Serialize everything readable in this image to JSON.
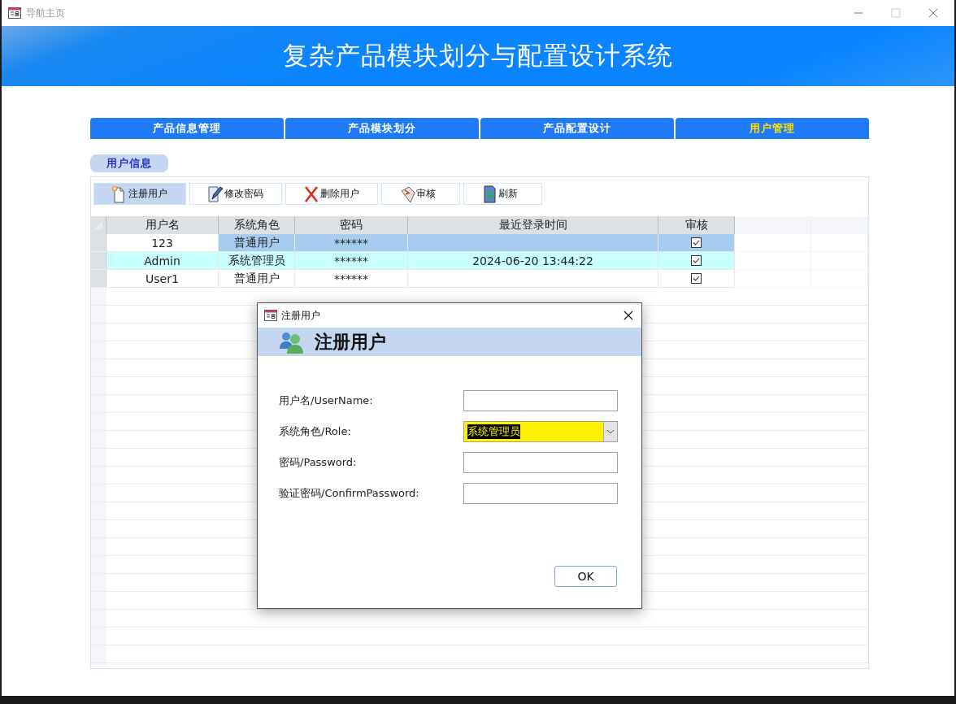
{
  "window": {
    "title": "导航主页"
  },
  "banner": {
    "title": "复杂产品模块划分与配置设计系统"
  },
  "tabs": [
    {
      "label": "产品信息管理",
      "selected": false
    },
    {
      "label": "产品模块划分",
      "selected": false
    },
    {
      "label": "产品配置设计",
      "selected": false
    },
    {
      "label": "用户管理",
      "selected": true
    }
  ],
  "section": {
    "label": "用户信息"
  },
  "toolbar": [
    {
      "label": "注册用户",
      "kind": "new",
      "selected": true
    },
    {
      "label": "修改密码",
      "kind": "edit",
      "selected": false
    },
    {
      "label": "删除用户",
      "kind": "delete",
      "selected": false
    },
    {
      "label": "审核",
      "kind": "review",
      "selected": false
    },
    {
      "label": "刷新",
      "kind": "refresh",
      "selected": false
    }
  ],
  "table": {
    "columns": [
      "用户名",
      "系统角色",
      "密码",
      "最近登录时间",
      "审核"
    ],
    "rows": [
      {
        "cells": [
          "123",
          "普通用户",
          "******",
          ""
        ],
        "checked": true,
        "selected": true,
        "highlighted": false
      },
      {
        "cells": [
          "Admin",
          "系统管理员",
          "******",
          "2024-06-20 13:44:22"
        ],
        "checked": true,
        "selected": false,
        "highlighted": true
      },
      {
        "cells": [
          "User1",
          "普通用户",
          "******",
          ""
        ],
        "checked": true,
        "selected": false,
        "highlighted": false
      }
    ]
  },
  "dialog": {
    "title": "注册用户",
    "header": "注册用户",
    "fields": [
      {
        "label": "用户名/UserName:",
        "kind": "text"
      },
      {
        "label": "系统角色/Role:",
        "kind": "combo",
        "value": "系统管理员"
      },
      {
        "label": "密码/Password:",
        "kind": "text"
      },
      {
        "label": "验证密码/ConfirmPassword:",
        "kind": "text"
      }
    ],
    "ok_button": "OK"
  }
}
